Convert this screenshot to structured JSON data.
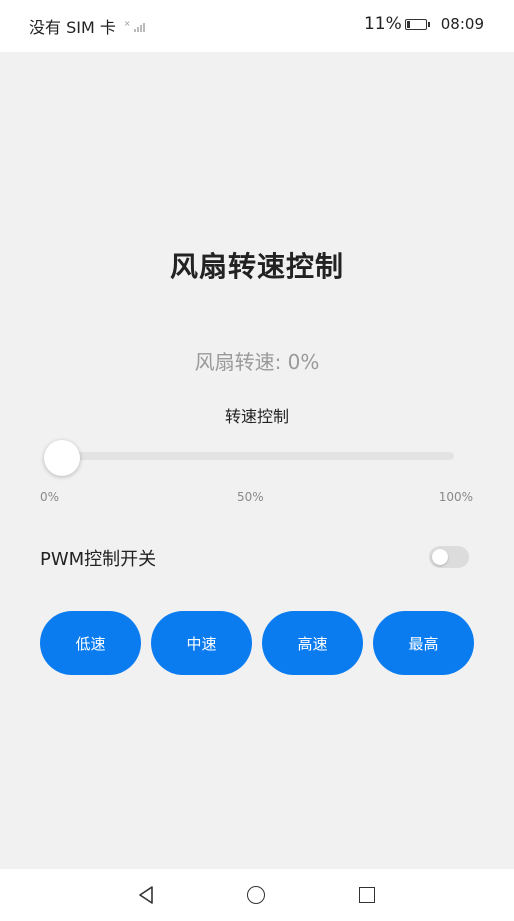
{
  "status_bar": {
    "carrier": "没有 SIM 卡",
    "battery_percent": "11%",
    "battery_level": 0.11,
    "time": "08:09"
  },
  "main": {
    "title": "风扇转速控制",
    "speed_display": "风扇转速: 0%",
    "slider": {
      "label": "转速控制",
      "value_percent": 0,
      "ticks": [
        "0%",
        "50%",
        "100%"
      ]
    },
    "pwm": {
      "label": "PWM控制开关",
      "enabled": false
    },
    "buttons": [
      "低速",
      "中速",
      "高速",
      "最高"
    ]
  },
  "colors": {
    "accent": "#0a7cf0",
    "background": "#f1f1f1"
  },
  "nav_bar": {
    "icons": [
      "back-icon",
      "home-icon",
      "recent-apps-icon"
    ]
  }
}
